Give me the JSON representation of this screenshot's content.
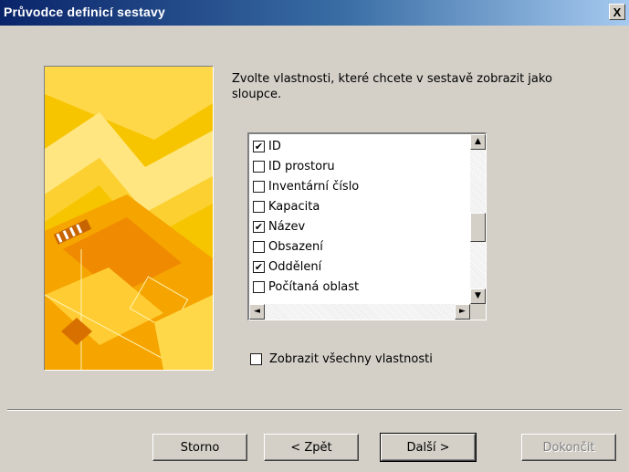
{
  "window": {
    "title": "Průvodce definicí sestavy",
    "close_glyph": "X"
  },
  "instructions": "Zvolte vlastnosti, které chcete v sestavě zobrazit jako sloupce.",
  "properties": [
    {
      "label": "ID",
      "checked": true
    },
    {
      "label": "ID prostoru",
      "checked": false
    },
    {
      "label": "Inventární číslo",
      "checked": false
    },
    {
      "label": "Kapacita",
      "checked": false
    },
    {
      "label": "Název",
      "checked": true
    },
    {
      "label": "Obsazení",
      "checked": false
    },
    {
      "label": "Oddělení",
      "checked": true
    },
    {
      "label": "Počítaná oblast",
      "checked": false
    }
  ],
  "show_all": {
    "label": "Zobrazit všechny vlastnosti",
    "checked": false
  },
  "buttons": {
    "cancel": "Storno",
    "back": "< Zpět",
    "next": "Další >",
    "finish": "Dokončit"
  },
  "glyphs": {
    "check": "✔",
    "up": "▲",
    "down": "▼",
    "left": "◄",
    "right": "►"
  },
  "colors": {
    "title_start": "#0a246a",
    "title_end": "#a6caf0",
    "dialog_bg": "#d4d0c8",
    "banner_yellow": "#f7c500",
    "banner_orange": "#f08a00"
  }
}
